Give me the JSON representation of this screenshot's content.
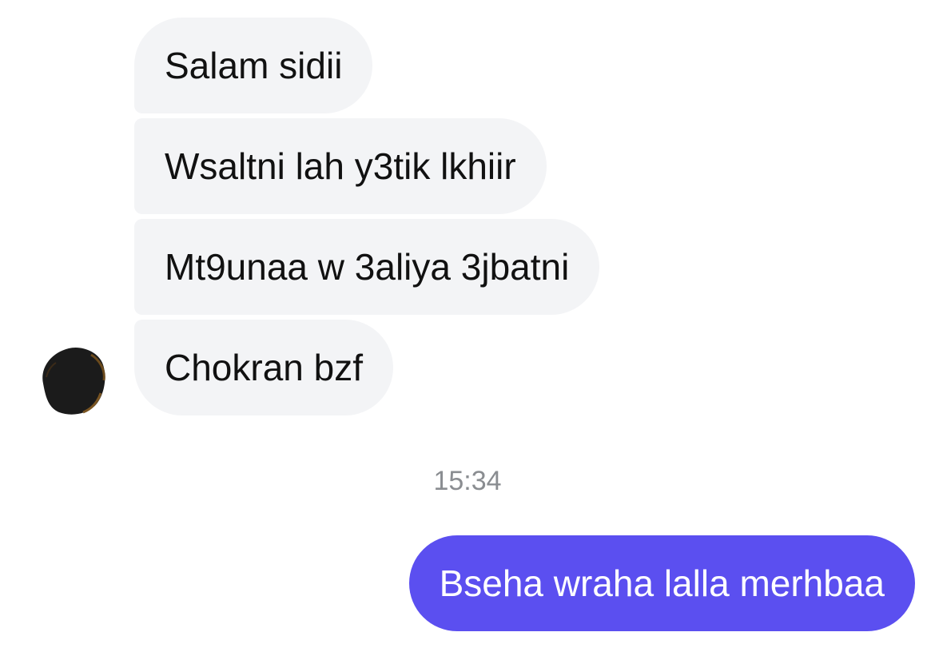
{
  "messages": {
    "incoming": [
      {
        "text": "Salam sidii"
      },
      {
        "text": "Wsaltni lah y3tik lkhiir"
      },
      {
        "text": "Mt9unaa w 3aliya 3jbatni"
      },
      {
        "text": "Chokran bzf"
      }
    ],
    "timestamp": "15:34",
    "outgoing": [
      {
        "text": "Bseha wraha lalla merhbaa"
      }
    ]
  },
  "colors": {
    "incoming_bubble": "#f3f4f6",
    "outgoing_bubble": "#5b4ff0",
    "timestamp_text": "#8a8d91"
  },
  "icons": {
    "avatar": "avatar"
  }
}
